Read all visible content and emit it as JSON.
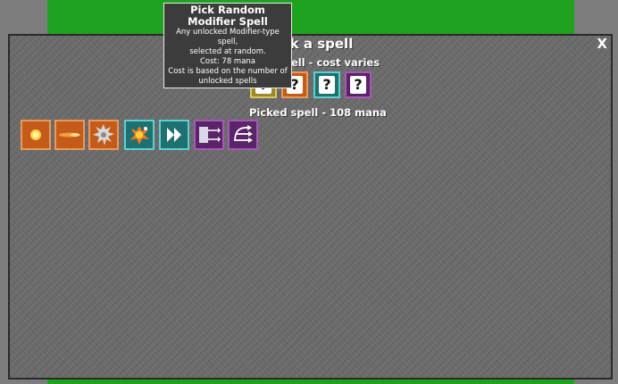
{
  "dialog": {
    "title": "Pick a spell",
    "close_label": "X"
  },
  "random_section": {
    "label": "Random spell - cost varies",
    "slots": [
      {
        "color": "yellow",
        "glyph": "?"
      },
      {
        "color": "orange",
        "glyph": "?"
      },
      {
        "color": "teal",
        "glyph": "?"
      },
      {
        "color": "purple",
        "glyph": "?"
      }
    ]
  },
  "picked_section": {
    "label": "Picked spell - 108 mana",
    "slots": [
      {
        "color": "orange",
        "icon": "fireball-icon"
      },
      {
        "color": "orange",
        "icon": "spark-bolt-icon"
      },
      {
        "color": "orange",
        "icon": "saw-blade-icon"
      },
      {
        "color": "teal",
        "icon": "explosion-icon"
      },
      {
        "color": "teal",
        "icon": "speed-up-icon"
      },
      {
        "color": "purple",
        "icon": "spread-arrows-icon"
      },
      {
        "color": "purple",
        "icon": "multicast-arrows-icon"
      }
    ]
  },
  "tooltip": {
    "title": "Pick Random Modifier Spell",
    "lines": [
      "Any unlocked Modifier-type spell,",
      "selected at random.",
      "Cost: 78 mana",
      "Cost is based on the number of",
      "unlocked spells"
    ]
  },
  "colors": {
    "background": "#7d7d7d",
    "field": "#1fa21f",
    "panel": "#6b6b6b",
    "orange": "#c55b1a",
    "teal": "#1f7070",
    "purple": "#5c2468"
  }
}
